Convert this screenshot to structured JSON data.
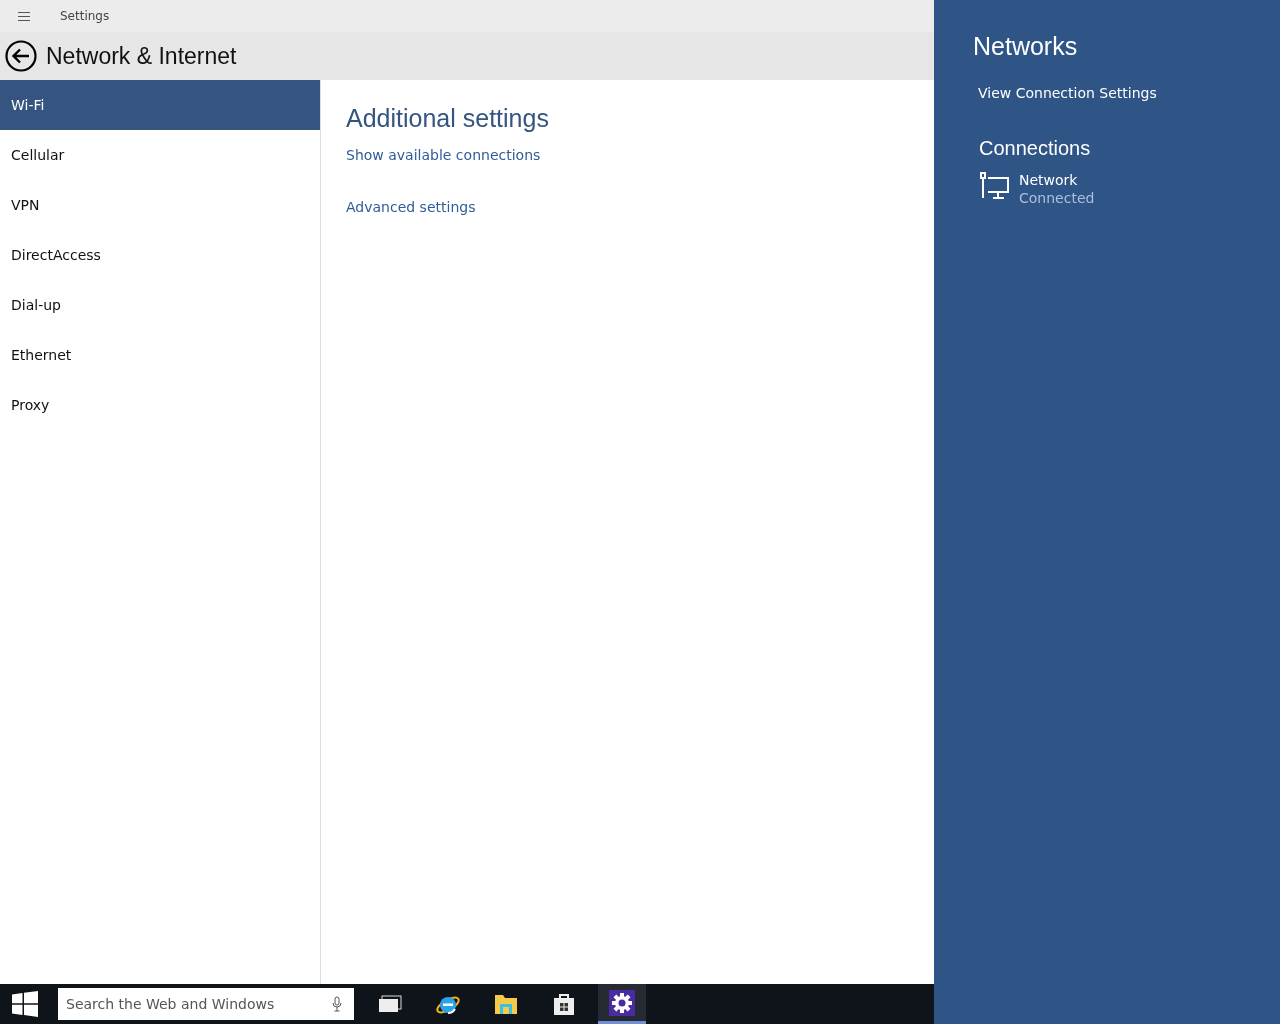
{
  "window": {
    "title": "Settings"
  },
  "header": {
    "title": "Network & Internet"
  },
  "sidebar": {
    "items": [
      {
        "label": "Wi-Fi",
        "selected": true
      },
      {
        "label": "Cellular",
        "selected": false
      },
      {
        "label": "VPN",
        "selected": false
      },
      {
        "label": "DirectAccess",
        "selected": false
      },
      {
        "label": "Dial-up",
        "selected": false
      },
      {
        "label": "Ethernet",
        "selected": false
      },
      {
        "label": "Proxy",
        "selected": false
      }
    ]
  },
  "content": {
    "heading": "Additional settings",
    "links": [
      "Show available connections",
      "Advanced settings"
    ]
  },
  "networks_panel": {
    "title": "Networks",
    "link": "View Connection Settings",
    "connections_heading": "Connections",
    "connections": [
      {
        "name": "Network",
        "status": "Connected"
      }
    ]
  },
  "taskbar": {
    "search": {
      "placeholder": "Search the Web and Windows"
    },
    "apps": [
      {
        "kind": "taskview",
        "selected": false
      },
      {
        "kind": "browser",
        "selected": false
      },
      {
        "kind": "folder",
        "selected": false
      },
      {
        "kind": "store",
        "selected": false
      },
      {
        "kind": "settings",
        "selected": true
      }
    ]
  }
}
